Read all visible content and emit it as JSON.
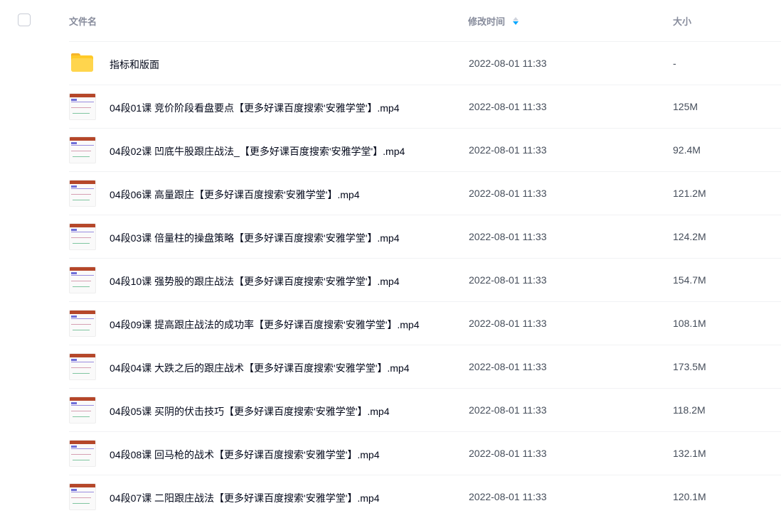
{
  "header": {
    "name_label": "文件名",
    "time_label": "修改时间",
    "size_label": "大小"
  },
  "files": [
    {
      "type": "folder",
      "name": "指标和版面",
      "time": "2022-08-01 11:33",
      "size": "-"
    },
    {
      "type": "video",
      "name": "04段01课 竞价阶段看盘要点【更多好课百度搜索'安雅学堂'】.mp4",
      "time": "2022-08-01 11:33",
      "size": "125M"
    },
    {
      "type": "video",
      "name": "04段02课 凹底牛股跟庄战法_【更多好课百度搜索'安雅学堂'】.mp4",
      "time": "2022-08-01 11:33",
      "size": "92.4M"
    },
    {
      "type": "video",
      "name": "04段06课 高量跟庄【更多好课百度搜索'安雅学堂'】.mp4",
      "time": "2022-08-01 11:33",
      "size": "121.2M"
    },
    {
      "type": "video",
      "name": "04段03课 倍量柱的操盘策略【更多好课百度搜索'安雅学堂'】.mp4",
      "time": "2022-08-01 11:33",
      "size": "124.2M"
    },
    {
      "type": "video",
      "name": "04段10课 强势股的跟庄战法【更多好课百度搜索'安雅学堂'】.mp4",
      "time": "2022-08-01 11:33",
      "size": "154.7M"
    },
    {
      "type": "video",
      "name": "04段09课 提高跟庄战法的成功率【更多好课百度搜索'安雅学堂'】.mp4",
      "time": "2022-08-01 11:33",
      "size": "108.1M"
    },
    {
      "type": "video",
      "name": "04段04课 大跌之后的跟庄战术【更多好课百度搜索'安雅学堂'】.mp4",
      "time": "2022-08-01 11:33",
      "size": "173.5M"
    },
    {
      "type": "video",
      "name": "04段05课 买阴的伏击技巧【更多好课百度搜索'安雅学堂'】.mp4",
      "time": "2022-08-01 11:33",
      "size": "118.2M"
    },
    {
      "type": "video",
      "name": "04段08课 回马枪的战术【更多好课百度搜索'安雅学堂'】.mp4",
      "time": "2022-08-01 11:33",
      "size": "132.1M"
    },
    {
      "type": "video",
      "name": "04段07课 二阳跟庄战法【更多好课百度搜索'安雅学堂'】.mp4",
      "time": "2022-08-01 11:33",
      "size": "120.1M"
    }
  ],
  "colors": {
    "accent": "#06a7ff",
    "folder": "#ffca28"
  }
}
